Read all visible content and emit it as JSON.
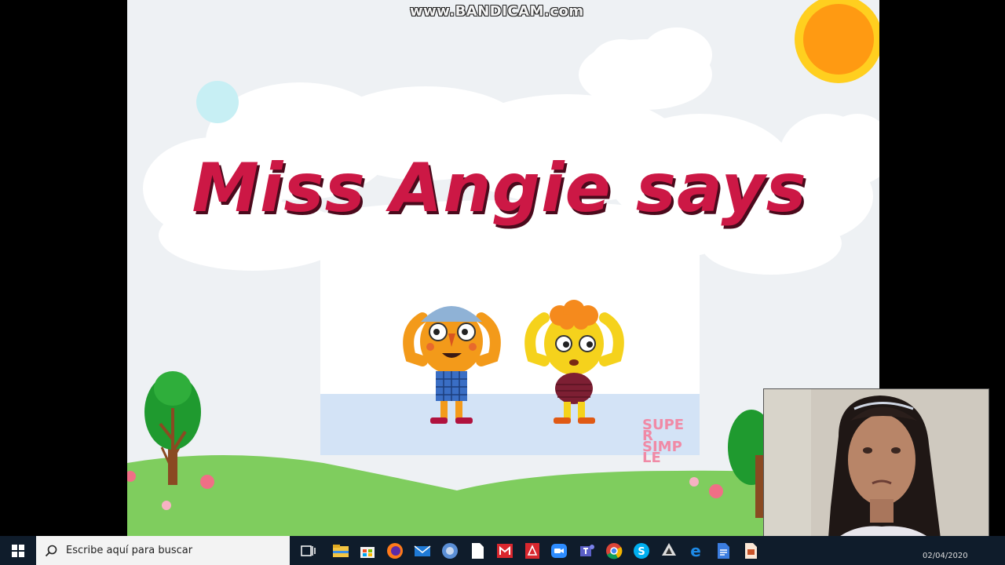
{
  "watermark": "www.BANDICAM.com",
  "slide": {
    "title": "Miss Angie says",
    "video_logo": "SUPER SIMPLE"
  },
  "taskbar": {
    "search_placeholder": "Escribe aquí para buscar",
    "icons": [
      "task-view-icon",
      "file-explorer-icon",
      "store-icon",
      "firefox-icon",
      "mail-icon",
      "settings-globe-icon",
      "document-icon",
      "mega-icon",
      "acrobat-icon",
      "zoom-icon",
      "teams-icon",
      "chrome-icon",
      "skype-icon",
      "inkscape-icon",
      "edge-icon",
      "word-docs-icon",
      "powerpoint-icon"
    ],
    "date_partial": "02/04/2020"
  },
  "colors": {
    "title": "#cc1845",
    "title_shadow": "#4a0a1c",
    "sun": "#ff9a12",
    "grass": "#7fcd5e",
    "taskbar": "#0f1c2b"
  }
}
